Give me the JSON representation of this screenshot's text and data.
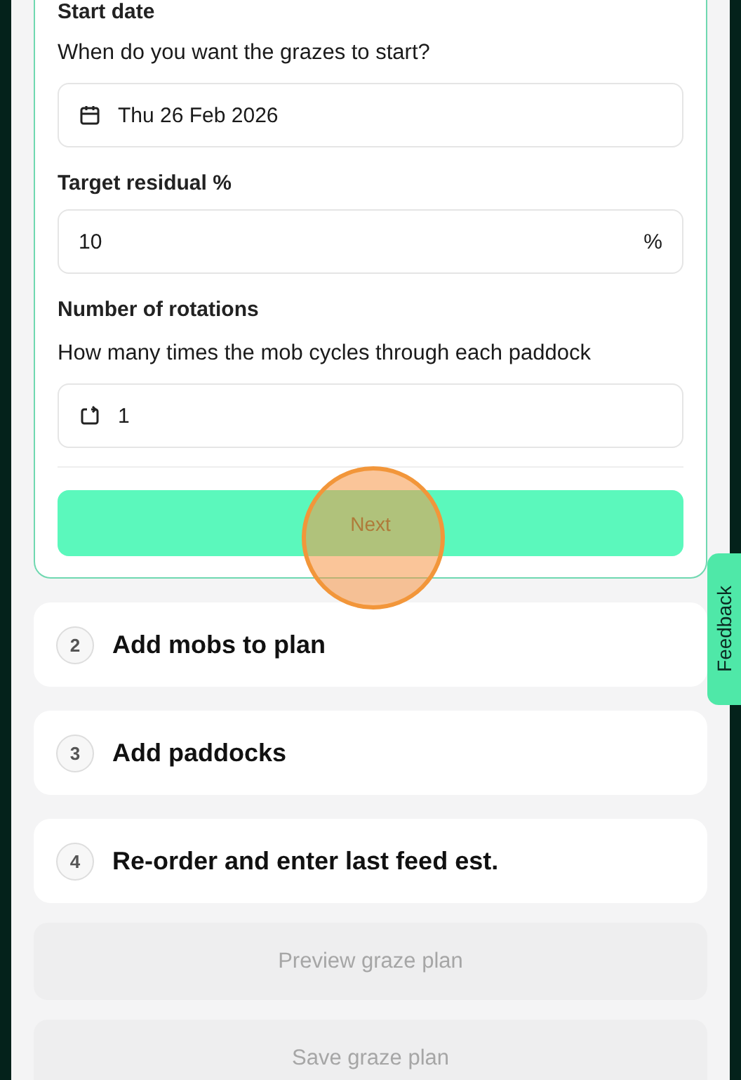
{
  "step_1": {
    "fields": [
      {
        "kind": "date",
        "label": "Start date",
        "description": "When do you want the grazes to start?",
        "value": "Thu 26 Feb 2026"
      },
      {
        "kind": "percent",
        "label": "Target residual %",
        "value": "10",
        "suffix": "%"
      },
      {
        "kind": "count",
        "label": "Number of rotations",
        "description": "How many times the mob cycles through each paddock",
        "value": "1"
      }
    ],
    "next_button": {
      "label": "Next",
      "disabled": false
    }
  },
  "steps": [
    {
      "number": "2",
      "title": "Add mobs to plan"
    },
    {
      "number": "3",
      "title": "Add paddocks"
    },
    {
      "number": "4",
      "title": "Re-order and enter last feed est."
    }
  ],
  "actions": [
    {
      "label": "Preview graze plan",
      "disabled": true
    },
    {
      "label": "Save graze plan",
      "disabled": true
    }
  ],
  "feedback_tab": {
    "label": "Feedback"
  }
}
